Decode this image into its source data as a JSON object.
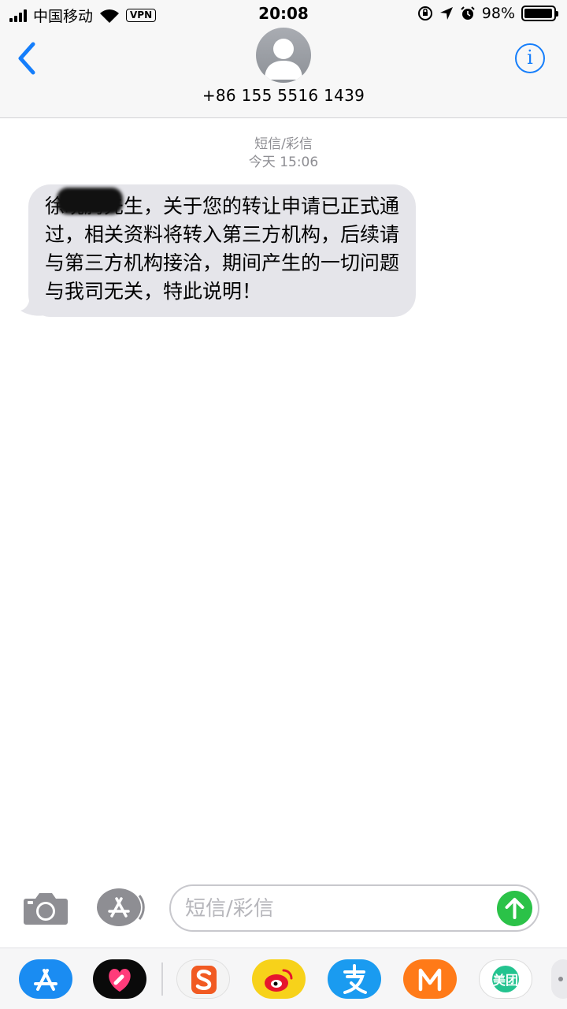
{
  "status_bar": {
    "carrier": "中国移动",
    "vpn": "VPN",
    "time": "20:08",
    "battery": "98%",
    "battery_level": 0.98
  },
  "header": {
    "contact": "+86 155 5516 1439",
    "info_icon": "info-icon",
    "info_glyph": "i",
    "back_icon": "chevron-left-icon"
  },
  "conversation": {
    "service": "短信/彩信",
    "timestamp": "今天 15:06",
    "message": "徐晓腾先生，关于您的转让申请已正式通过，相关资料将转入第三方机构，后续请与第三方机构接洽，期间产生的一切问题与我司无关，特此说明！"
  },
  "input": {
    "placeholder": "短信/彩信"
  },
  "apps": {
    "meituan_label": "美团"
  },
  "colors": {
    "accent": "#157efb",
    "bubble": "#e5e5ea",
    "send": "#2bc248"
  }
}
